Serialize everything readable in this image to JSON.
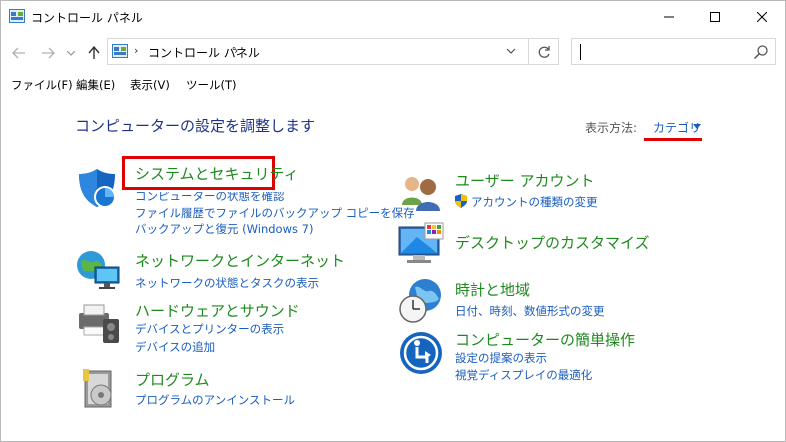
{
  "window": {
    "title": "コントロール パネル",
    "minimize": "—",
    "maximize": "☐",
    "close": "✕"
  },
  "address": {
    "path": "コントロール パネル",
    "sep": "›",
    "search_placeholder": ""
  },
  "menu": [
    "ファイル(F)",
    "編集(E)",
    "表示(V)",
    "ツール(T)"
  ],
  "main": {
    "heading": "コンピューターの設定を調整します",
    "view_by_label": "表示方法:",
    "view_by_value": "カテゴリ",
    "left_categories": [
      {
        "icon": "shield-icon",
        "title": "システムとセキュリティ",
        "links": [
          "コンピューターの状態を確認",
          "ファイル履歴でファイルのバックアップ コピーを保存",
          "バックアップと復元 (Windows 7)"
        ]
      },
      {
        "icon": "network-icon",
        "title": "ネットワークとインターネット",
        "links": [
          "ネットワークの状態とタスクの表示"
        ]
      },
      {
        "icon": "printer-icon",
        "title": "ハードウェアとサウンド",
        "links": [
          "デバイスとプリンターの表示",
          "デバイスの追加"
        ]
      },
      {
        "icon": "programs-icon",
        "title": "プログラム",
        "links": [
          "プログラムのアンインストール"
        ]
      }
    ],
    "right_categories": [
      {
        "icon": "users-icon",
        "title": "ユーザー アカウント",
        "links": [
          "アカウントの種類の変更"
        ]
      },
      {
        "icon": "desktop-icon",
        "title": "デスクトップのカスタマイズ",
        "links": []
      },
      {
        "icon": "clock-globe-icon",
        "title": "時計と地域",
        "links": [
          "日付、時刻、数値形式の変更"
        ]
      },
      {
        "icon": "ease-of-access-icon",
        "title": "コンピューターの簡単操作",
        "links": [
          "設定の提案の表示",
          "視覚ディスプレイの最適化"
        ]
      }
    ]
  },
  "colors": {
    "heading": "#1e3287",
    "category_title": "#1e8a1e",
    "link": "#1a5dbf",
    "highlight": "#e00000"
  }
}
